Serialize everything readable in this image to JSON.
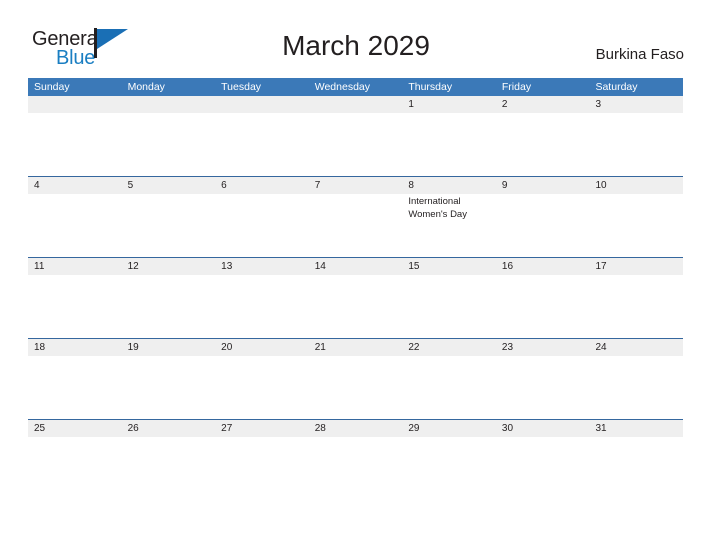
{
  "brand": {
    "name_part1": "General",
    "name_part2": "Blue",
    "flag_icon": "flag-icon",
    "accent_color": "#1a6fb5"
  },
  "header": {
    "title": "March 2029",
    "country": "Burkina Faso"
  },
  "theme": {
    "header_blue": "#3b79b8",
    "row_line": "#35679e",
    "band_gray": "#efefef",
    "text": "#231f20"
  },
  "calendar": {
    "day_headers": [
      "Sunday",
      "Monday",
      "Tuesday",
      "Wednesday",
      "Thursday",
      "Friday",
      "Saturday"
    ],
    "weeks": [
      [
        {
          "date": "",
          "event": ""
        },
        {
          "date": "",
          "event": ""
        },
        {
          "date": "",
          "event": ""
        },
        {
          "date": "",
          "event": ""
        },
        {
          "date": "1",
          "event": ""
        },
        {
          "date": "2",
          "event": ""
        },
        {
          "date": "3",
          "event": ""
        }
      ],
      [
        {
          "date": "4",
          "event": ""
        },
        {
          "date": "5",
          "event": ""
        },
        {
          "date": "6",
          "event": ""
        },
        {
          "date": "7",
          "event": ""
        },
        {
          "date": "8",
          "event": "International Women's Day"
        },
        {
          "date": "9",
          "event": ""
        },
        {
          "date": "10",
          "event": ""
        }
      ],
      [
        {
          "date": "11",
          "event": ""
        },
        {
          "date": "12",
          "event": ""
        },
        {
          "date": "13",
          "event": ""
        },
        {
          "date": "14",
          "event": ""
        },
        {
          "date": "15",
          "event": ""
        },
        {
          "date": "16",
          "event": ""
        },
        {
          "date": "17",
          "event": ""
        }
      ],
      [
        {
          "date": "18",
          "event": ""
        },
        {
          "date": "19",
          "event": ""
        },
        {
          "date": "20",
          "event": ""
        },
        {
          "date": "21",
          "event": ""
        },
        {
          "date": "22",
          "event": ""
        },
        {
          "date": "23",
          "event": ""
        },
        {
          "date": "24",
          "event": ""
        }
      ],
      [
        {
          "date": "25",
          "event": ""
        },
        {
          "date": "26",
          "event": ""
        },
        {
          "date": "27",
          "event": ""
        },
        {
          "date": "28",
          "event": ""
        },
        {
          "date": "29",
          "event": ""
        },
        {
          "date": "30",
          "event": ""
        },
        {
          "date": "31",
          "event": ""
        }
      ]
    ]
  }
}
